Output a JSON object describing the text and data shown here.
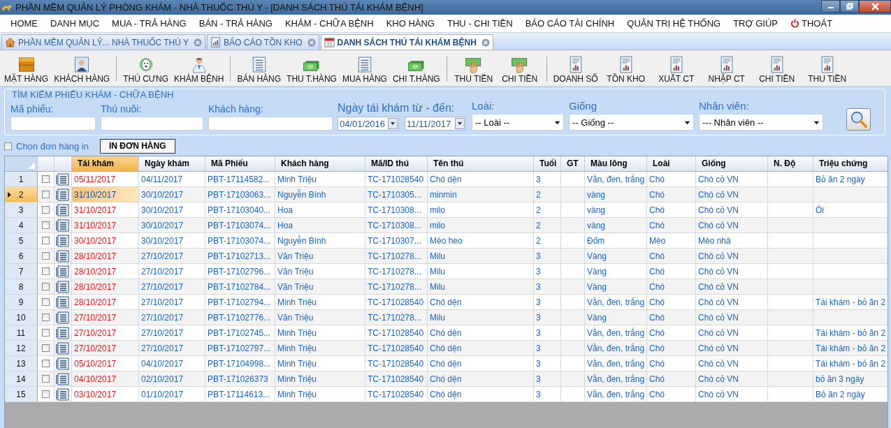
{
  "window": {
    "title": "PHẦN MỀM QUẢN LÝ PHÒNG KHÁM - NHÀ THUỐC THÚ Y - [DANH SÁCH THÚ TÁI KHÁM BỆNH]"
  },
  "menu": [
    {
      "label": "HOME",
      "kind": "item"
    },
    {
      "label": "DANH MỤC",
      "kind": "item"
    },
    {
      "label": "MUA - TRẢ HÀNG",
      "kind": "item"
    },
    {
      "label": "BÁN - TRẢ HÀNG",
      "kind": "item"
    },
    {
      "label": "KHÁM - CHỮA BỆNH",
      "kind": "item"
    },
    {
      "label": "KHO HÀNG",
      "kind": "item"
    },
    {
      "label": "THU - CHI TIỀN",
      "kind": "item"
    },
    {
      "label": "BÁO CÁO TÀI CHÍNH",
      "kind": "item"
    },
    {
      "label": "QUẢN TRỊ HỆ THỐNG",
      "kind": "item"
    },
    {
      "label": "TRỢ GIÚP",
      "kind": "item"
    },
    {
      "label": "THOÁT",
      "kind": "exit"
    }
  ],
  "tabs": [
    {
      "label": "PHẦN MỀM QUẢN LÝ... NHÀ THUỐC THÚ Y",
      "kind": "home",
      "selected": false
    },
    {
      "label": "BÁO CÁO TỒN KHO",
      "kind": "report",
      "selected": false
    },
    {
      "label": "DANH SÁCH THÚ TÁI KHÁM BỆNH",
      "kind": "calendar",
      "selected": true
    }
  ],
  "toolbar": [
    {
      "buttons": [
        {
          "label": "MẶT HÀNG",
          "kind": "box"
        },
        {
          "label": "KHÁCH HÀNG",
          "kind": "customer"
        }
      ]
    },
    {
      "buttons": [
        {
          "label": "THÚ CƯNG",
          "kind": "pet"
        },
        {
          "label": "KHÁM BỆNH",
          "kind": "doctor"
        }
      ]
    },
    {
      "buttons": [
        {
          "label": "BÁN HÀNG",
          "kind": "list"
        },
        {
          "label": "THU T.HÀNG",
          "kind": "money"
        },
        {
          "label": "MUA HÀNG",
          "kind": "list"
        },
        {
          "label": "CHI T.HÀNG",
          "kind": "money"
        }
      ]
    },
    {
      "buttons": [
        {
          "label": "THU TIỀN",
          "kind": "hand"
        },
        {
          "label": "CHI TIỀN",
          "kind": "hand"
        }
      ]
    },
    {
      "buttons": [
        {
          "label": "DOANH SỐ",
          "kind": "report"
        },
        {
          "label": "TỒN KHO",
          "kind": "report"
        },
        {
          "label": "XUẤT CT",
          "kind": "report"
        },
        {
          "label": "NHẬP CT",
          "kind": "report"
        },
        {
          "label": "CHI TIỀN",
          "kind": "report"
        },
        {
          "label": "THU TIỀN",
          "kind": "report"
        }
      ]
    }
  ],
  "search": {
    "title": "TÌM KIẾM PHIẾU KHÁM - CHỮA BỆNH",
    "fields": [
      {
        "kind": "text",
        "label": "Mã phiếu:"
      },
      {
        "kind": "text",
        "label": "Thú nuôi:"
      },
      {
        "kind": "text",
        "label": "Khách hàng:"
      },
      {
        "kind": "dates",
        "label": "Ngày tái khám từ - đến:",
        "from": "04/01/2016",
        "to": "11/11/2017"
      },
      {
        "kind": "select",
        "label": "Loài:",
        "value": "-- Loài --"
      },
      {
        "kind": "select",
        "label": "Giống",
        "value": "-- Giống --"
      },
      {
        "kind": "select",
        "label": "Nhân viên:",
        "value": "--- Nhân viên --"
      }
    ]
  },
  "print": {
    "checkbox_label": "Chọn đơn hàng in",
    "checked": false,
    "button": "IN ĐƠN HÀNG"
  },
  "table": {
    "columns": [
      "Tái khám",
      "Ngày khám",
      "Mã Phiếu",
      "Khách hàng",
      "Mã/ID thú",
      "Tên thú",
      "Tuổi",
      "GT",
      "Màu lông",
      "Loài",
      "Giống",
      "N. Độ",
      "Triệu chứng"
    ],
    "rows": [
      {
        "number": "1",
        "selected": false,
        "checked": false,
        "cells": [
          "05/11/2017",
          "04/11/2017",
          "PBT-17114582...",
          "Minh Triệu",
          "TC-171028540",
          "Chó dện",
          "3",
          "",
          "Vằn, đen, trắng",
          "Chó",
          "Chó cỏ VN",
          "",
          "Bỏ ăn 2 ngày"
        ]
      },
      {
        "number": "2",
        "selected": true,
        "checked": false,
        "cells": [
          "31/10/2017",
          "30/10/2017",
          "PBT-17103063...",
          "Nguyễn Bính",
          "TC-1710305...",
          "minmin",
          "2",
          "",
          "vàng",
          "Chó",
          "Chó cỏ VN",
          "",
          ""
        ]
      },
      {
        "number": "3",
        "selected": false,
        "checked": false,
        "cells": [
          "31/10/2017",
          "30/10/2017",
          "PBT-17103040...",
          "Hoa",
          "TC-1710308...",
          "milo",
          "2",
          "",
          "vàng",
          "Chó",
          "Chó cỏ VN",
          "",
          "Ói"
        ]
      },
      {
        "number": "4",
        "selected": false,
        "checked": false,
        "cells": [
          "31/10/2017",
          "30/10/2017",
          "PBT-17103074...",
          "Hoa",
          "TC-1710308...",
          "milo",
          "2",
          "",
          "vàng",
          "Chó",
          "Chó cỏ VN",
          "",
          ""
        ]
      },
      {
        "number": "5",
        "selected": false,
        "checked": false,
        "cells": [
          "30/10/2017",
          "30/10/2017",
          "PBT-17103074...",
          "Nguyễn Bính",
          "TC-1710307...",
          "Mèo heo",
          "2",
          "",
          "Đốm",
          "Mèo",
          "Mèo nhà",
          "",
          ""
        ]
      },
      {
        "number": "6",
        "selected": false,
        "checked": false,
        "cells": [
          "28/10/2017",
          "27/10/2017",
          "PBT-17102713...",
          "Văn Triệu",
          "TC-1710278...",
          "Milu",
          "3",
          "",
          "Vàng",
          "Chó",
          "Chó cỏ VN",
          "",
          ""
        ]
      },
      {
        "number": "7",
        "selected": false,
        "checked": false,
        "cells": [
          "28/10/2017",
          "27/10/2017",
          "PBT-17102796...",
          "Văn Triệu",
          "TC-1710278...",
          "Milu",
          "3",
          "",
          "Vàng",
          "Chó",
          "Chó cỏ VN",
          "",
          ""
        ]
      },
      {
        "number": "8",
        "selected": false,
        "checked": false,
        "cells": [
          "28/10/2017",
          "27/10/2017",
          "PBT-17102784...",
          "Văn Triệu",
          "TC-1710278...",
          "Milu",
          "3",
          "",
          "Vàng",
          "Chó",
          "Chó cỏ VN",
          "",
          ""
        ]
      },
      {
        "number": "9",
        "selected": false,
        "checked": false,
        "cells": [
          "28/10/2017",
          "27/10/2017",
          "PBT-17102794...",
          "Minh Triệu",
          "TC-171028540",
          "Chó dện",
          "3",
          "",
          "Vằn, đen, trắng",
          "Chó",
          "Chó cỏ VN",
          "",
          "Tái khám - bỏ ăn 2"
        ]
      },
      {
        "number": "10",
        "selected": false,
        "checked": false,
        "cells": [
          "27/10/2017",
          "27/10/2017",
          "PBT-17102776...",
          "Văn Triệu",
          "TC-1710278...",
          "Milu",
          "3",
          "",
          "Vàng",
          "Chó",
          "Chó cỏ VN",
          "",
          ""
        ]
      },
      {
        "number": "11",
        "selected": false,
        "checked": false,
        "cells": [
          "27/10/2017",
          "27/10/2017",
          "PBT-17102745...",
          "Minh Triệu",
          "TC-171028540",
          "Chó dện",
          "3",
          "",
          "Vằn, đen, trắng",
          "Chó",
          "Chó cỏ VN",
          "",
          "Tái khám - bỏ ăn 2"
        ]
      },
      {
        "number": "12",
        "selected": false,
        "checked": false,
        "cells": [
          "27/10/2017",
          "27/10/2017",
          "PBT-17102797...",
          "Minh Triệu",
          "TC-171028540",
          "Chó dện",
          "3",
          "",
          "Vằn, đen, trắng",
          "Chó",
          "Chó cỏ VN",
          "",
          "Tái khám - bỏ ăn 2"
        ]
      },
      {
        "number": "13",
        "selected": false,
        "checked": false,
        "cells": [
          "05/10/2017",
          "04/10/2017",
          "PBT-17104998...",
          "Minh Triệu",
          "TC-171028540",
          "Chó dện",
          "3",
          "",
          "Vằn, đen, trắng",
          "Chó",
          "Chó cỏ VN",
          "",
          "Tái khám - bỏ ăn 2"
        ]
      },
      {
        "number": "14",
        "selected": false,
        "checked": false,
        "cells": [
          "04/10/2017",
          "02/10/2017",
          "PBT-171026373",
          "Minh Triệu",
          "TC-171028540",
          "Chó dện",
          "3",
          "",
          "Vằn, đen, trắng",
          "Chó",
          "Chó cỏ VN",
          "",
          "bỏ ăn 3 ngày"
        ]
      },
      {
        "number": "15",
        "selected": false,
        "checked": false,
        "cells": [
          "03/10/2017",
          "01/10/2017",
          "PBT-17114613...",
          "Minh Triệu",
          "TC-171028540",
          "Chó dện",
          "3",
          "",
          "Vằn, đen, trắng",
          "Chó",
          "Chó cỏ VN",
          "",
          "Bỏ ăn 2 ngày"
        ]
      }
    ]
  }
}
